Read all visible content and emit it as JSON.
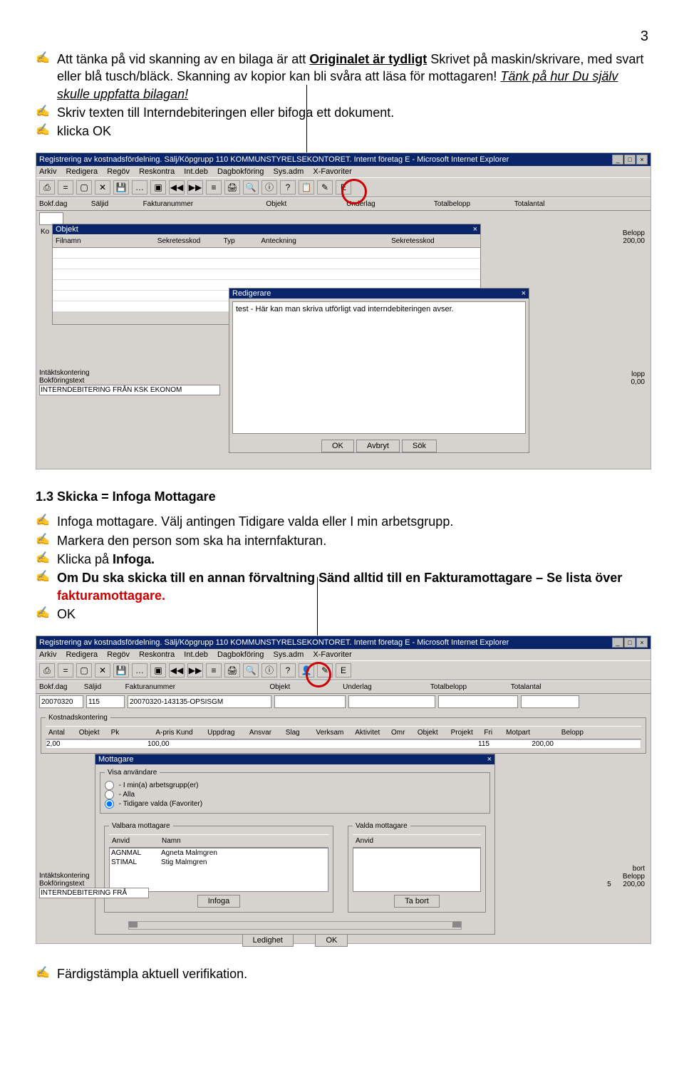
{
  "page_number": "3",
  "intro_bullets": [
    {
      "pre": "Att tänka på vid skanning av en bilaga är att ",
      "u": "Originalet är tydligt",
      "post": " Skrivet på maskin/skrivare, med svart eller blå tusch/bläck. Skanning av kopior kan bli svåra att läsa för mottagaren! ",
      "tail_i_u": "Tänk på hur Du själv skulle uppfatta bilagan!"
    },
    {
      "plain": "Skriv texten till Interndebiteringen eller bifoga ett dokument."
    },
    {
      "plain": "klicka OK"
    }
  ],
  "screenshot1": {
    "title": "Registrering av kostnadsfördelning. Sälj/Köpgrupp 110 KOMMUNSTYRELSEKONTORET. Internt företag E - Microsoft Internet Explorer",
    "menu": [
      "Arkiv",
      "Redigera",
      "Regöv",
      "Reskontra",
      "Int.deb",
      "Dagbokföring",
      "Sys.adm",
      "X-Favoriter"
    ],
    "cols1": [
      "Bokf.dag",
      "Säljid",
      "Fakturanummer",
      "Objekt",
      "Underlag",
      "Totalbelopp",
      "Totalantal"
    ],
    "objekt_title": "Objekt",
    "objekt_cols": [
      "Filnamn",
      "Sekretesskod",
      "Typ",
      "Anteckning",
      "Sekretesskod"
    ],
    "belopp_label": "Belopp",
    "belopp_value": "200,00",
    "editor_title": "Redigerare",
    "editor_text": "test - Här kan man skriva utförligt vad interndebiteringen avser.",
    "intakts_label": "Intäktskontering",
    "bokf_label": "Bokföringstext",
    "bokf_value": "INTERNDEBITERING FRÅN KSK EKONOM",
    "lopp": "lopp",
    "lopp_val": "0,00",
    "btn_ok": "OK",
    "btn_avbryt": "Avbryt",
    "btn_sok": "Sök"
  },
  "section_heading": "1.3 Skicka  =  Infoga Mottagare",
  "mid_bullets": [
    "Infoga mottagare. Välj antingen Tidigare valda eller I min arbetsgrupp.",
    "Markera den person som ska ha internfakturan."
  ],
  "mid_bullet_bold": {
    "pre": "Klicka på ",
    "b": "Infoga."
  },
  "mid_bullet_mix": {
    "b1": "Om Du ska skicka till en annan förvaltning Sänd alltid till en Fakturamottagare – Se lista över ",
    "red": "fakturamottagare."
  },
  "mid_bullet_ok": "OK",
  "screenshot2": {
    "title": "Registrering av kostnadsfördelning. Sälj/Köpgrupp 110 KOMMUNSTYRELSEKONTORET. Internt företag E - Microsoft Internet Explorer",
    "menu": [
      "Arkiv",
      "Redigera",
      "Regöv",
      "Reskontra",
      "Int.deb",
      "Dagbokföring",
      "Sys.adm",
      "X-Favoriter"
    ],
    "cols1": [
      "Bokf.dag",
      "Säljid",
      "Fakturanummer",
      "Objekt",
      "Underlag",
      "Totalbelopp",
      "Totalantal"
    ],
    "row1": {
      "bokfdag": "20070320",
      "saljid": "115",
      "faktura": "20070320-143135-OPSISGM"
    },
    "kostn_cols": [
      "Antal",
      "Objekt",
      "Pk",
      "A-pris Kund",
      "Uppdrag",
      "Ansvar",
      "Slag",
      "Verksam",
      "Aktivitet",
      "Omr",
      "Objekt",
      "Projekt",
      "Fri",
      "Motpart",
      "Belopp"
    ],
    "kostn_label": "Kostnadskontering",
    "kostn_row": {
      "antal": "2,00",
      "apris": "100,00",
      "motpart": "115",
      "belopp": "200,00"
    },
    "mottagare_title": "Mottagare",
    "visa_label": "Visa användare",
    "radio1": "- I min(a) arbetsgrupp(er)",
    "radio2": "- Alla",
    "radio3": "- Tidigare valda (Favoriter)",
    "valbara": "Valbara mottagare",
    "valda": "Valda mottagare",
    "col_anvid": "Anvid",
    "col_namn": "Namn",
    "rows": [
      {
        "anvid": "AGNMAL",
        "namn": "Agneta Malmgren"
      },
      {
        "anvid": "STIMAL",
        "namn": "Stig Malmgren"
      }
    ],
    "btn_infoga": "Infoga",
    "btn_tabort": "Ta bort",
    "intakts_label": "Intäktskontering",
    "bokf_label": "Bokföringstext",
    "bokf_value": "INTERNDEBITERING FRÅ",
    "bort": "bort",
    "five": "5",
    "belopp": "Belopp",
    "belopp_val": "200,00",
    "btn_ledighet": "Ledighet",
    "btn_ok": "OK"
  },
  "final_bullet": "Färdigstämpla aktuell verifikation."
}
